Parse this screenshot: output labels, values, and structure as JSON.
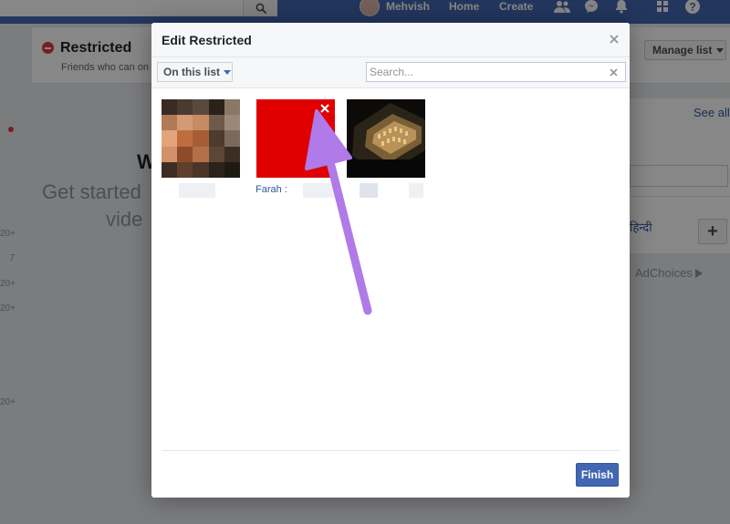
{
  "app": {
    "user_name": "Mehvish",
    "nav_home": "Home",
    "nav_create": "Create"
  },
  "background": {
    "list_title": "Restricted",
    "list_subtitle": "Friends who can on",
    "manage_list_label": "Manage list",
    "see_all_label": "See all",
    "language_link": "हिन्दी",
    "adchoices_label": "AdChoices",
    "headline_fragment": "W",
    "get_started_fragment": "Get started",
    "video_fragment": "vide",
    "side_numbers": [
      "20+",
      "7",
      "20+",
      "20+",
      "20+"
    ]
  },
  "dialog": {
    "title": "Edit Restricted",
    "filter_label": "On this list",
    "search_placeholder": "Search...",
    "finish_label": "Finish",
    "friends": [
      {
        "name": "Farah :",
        "tile_color": "#e00000"
      }
    ]
  },
  "colors": {
    "brand": "#4267b2",
    "link": "#365899",
    "annotation_arrow": "#b07ae8",
    "restricted_badge": "#e0393e"
  },
  "icons": {
    "search": "search-icon",
    "close": "close-icon",
    "remove": "remove-icon",
    "annotation": "annotation-arrow"
  }
}
